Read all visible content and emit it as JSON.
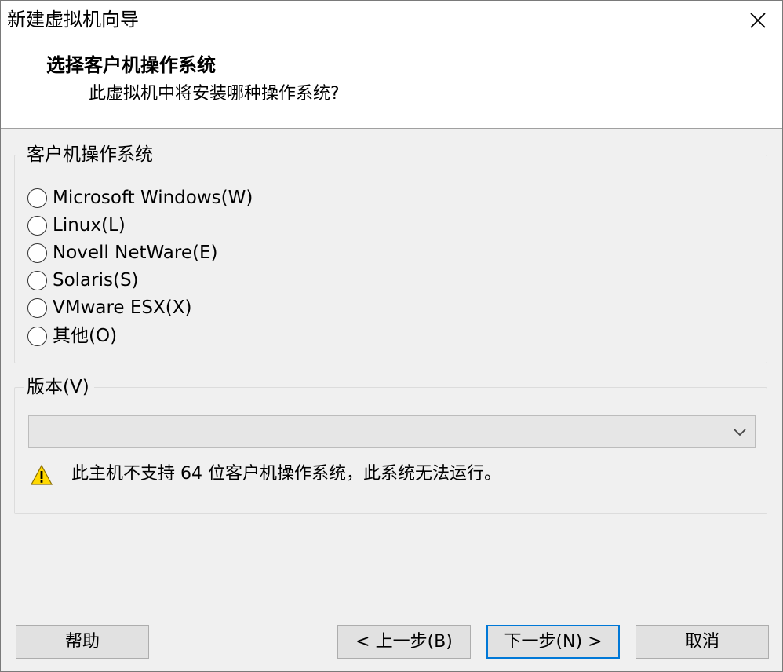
{
  "window": {
    "title": "新建虚拟机向导"
  },
  "header": {
    "title": "选择客户机操作系统",
    "subtitle": "此虚拟机中将安装哪种操作系统?"
  },
  "os_group": {
    "legend": "客户机操作系统",
    "options": [
      {
        "label": "Microsoft Windows(W)",
        "selected": false
      },
      {
        "label": "Linux(L)",
        "selected": false
      },
      {
        "label": "Novell NetWare(E)",
        "selected": false
      },
      {
        "label": "Solaris(S)",
        "selected": false
      },
      {
        "label": "VMware ESX(X)",
        "selected": false
      },
      {
        "label": "其他(O)",
        "selected": false
      }
    ]
  },
  "version_group": {
    "legend": "版本(V)",
    "selected_value": "",
    "warning": "此主机不支持 64 位客户机操作系统，此系统无法运行。"
  },
  "buttons": {
    "help": "帮助",
    "back": "< 上一步(B)",
    "next": "下一步(N) >",
    "cancel": "取消"
  },
  "colors": {
    "focus_border": "#0078d7",
    "warning_fill": "#ffd800"
  }
}
